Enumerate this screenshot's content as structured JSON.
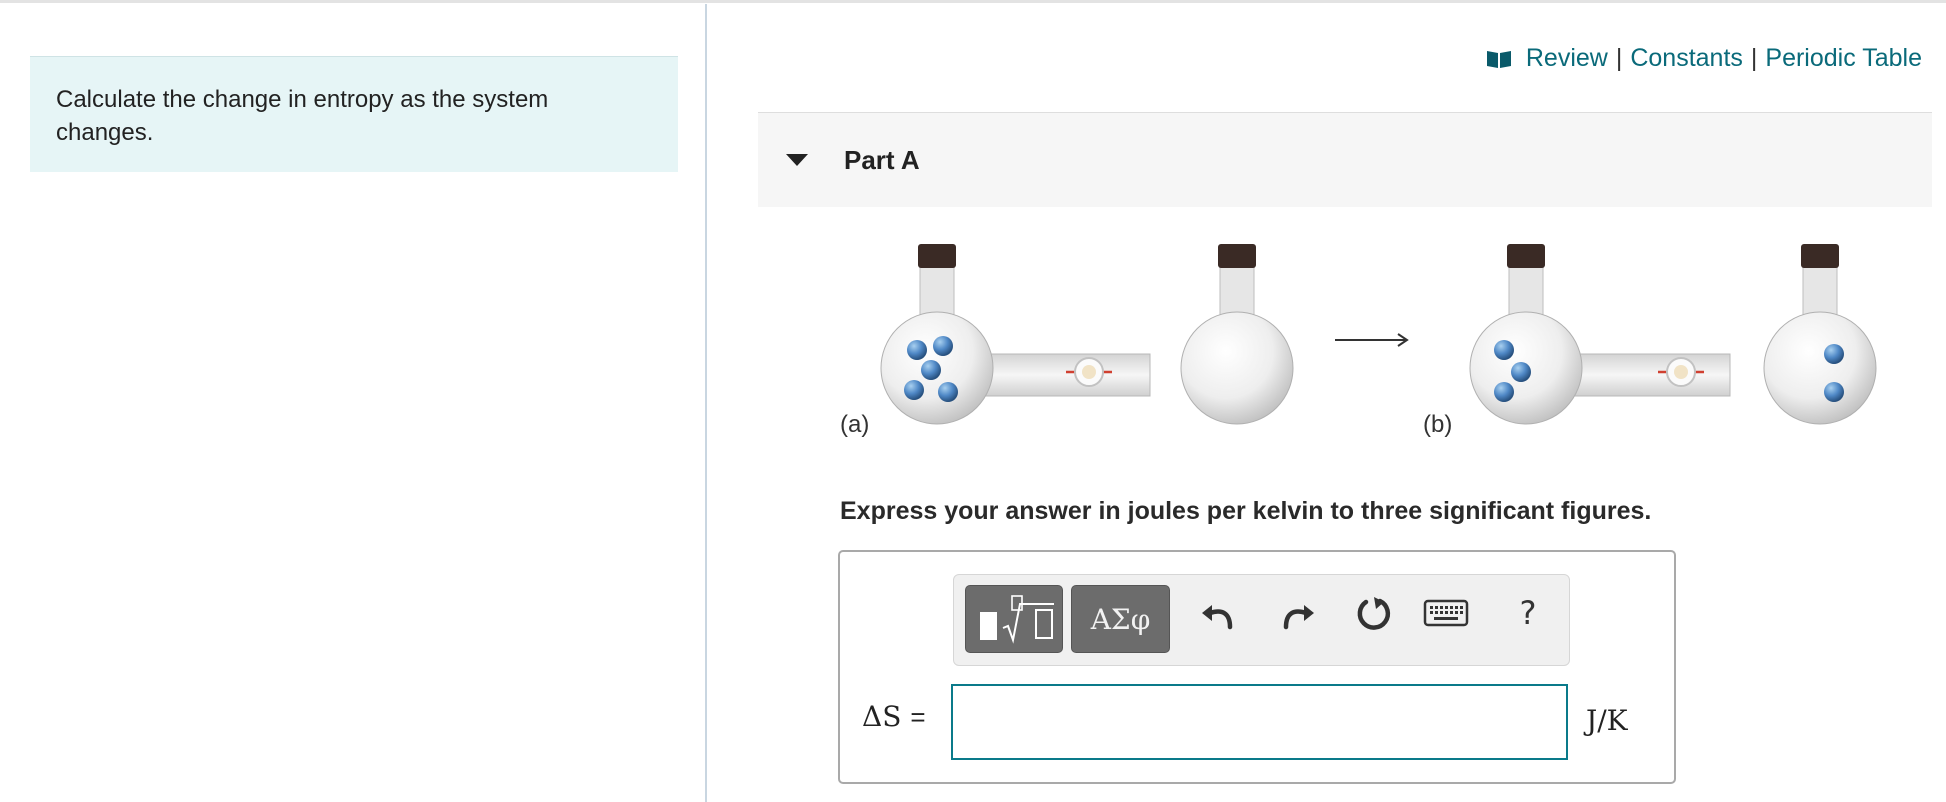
{
  "intro": {
    "text": "Calculate the change in entropy as the system changes."
  },
  "resources": {
    "review": "Review",
    "constants": "Constants",
    "periodic_table": "Periodic Table",
    "separator": "|",
    "icon": "book-icon"
  },
  "part": {
    "title": "Part A",
    "expanded": true
  },
  "figure": {
    "label_a": "(a)",
    "label_b": "(b)"
  },
  "instruction": "Express your answer in joules per kelvin to three significant figures.",
  "toolbar": {
    "templates_icon": "templates-icon",
    "symbols_label": "ΑΣφ",
    "undo_icon": "undo-icon",
    "redo_icon": "redo-icon",
    "reset_icon": "reset-icon",
    "keyboard_icon": "keyboard-icon",
    "help_label": "?"
  },
  "answer": {
    "variable": "ΔS",
    "equals": "=",
    "value": "",
    "units": "J/K"
  },
  "colors": {
    "link": "#0a6a7a",
    "intro_bg": "#e6f5f6",
    "input_border": "#0a7a8a",
    "toolbar_button": "#6c6c6c"
  }
}
